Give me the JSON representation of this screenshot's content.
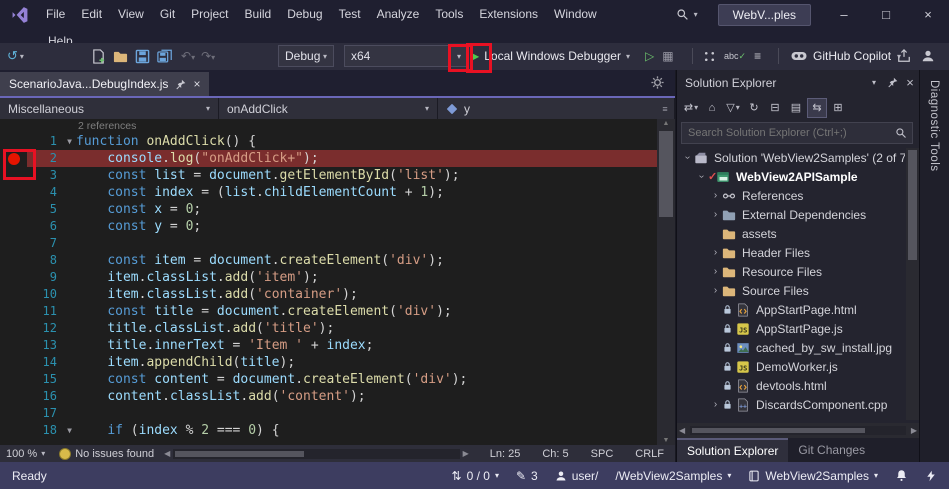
{
  "colors": {
    "titlebar_bg": "#1f1f30",
    "toolbar_bg": "#2d2d3d",
    "editor_bg": "#1e1e1e",
    "panel_bg": "#24242f",
    "statusbar_bg": "#3d3d60",
    "accent_line": "#6a67b8",
    "annotation_red": "#e81123",
    "breakpoint_red": "#e51400",
    "breakpoint_line_bg": "#7a2d2d",
    "start_green": "#4ec94e",
    "kw": "#569cd6",
    "ident": "#9cdcfe",
    "func": "#dcdcaa",
    "string": "#d69d85",
    "number": "#b5cea8",
    "punct": "#d4d4d4",
    "linenum": "#2b91af",
    "codelens": "#7f7f7f"
  },
  "titlebar": {
    "menus": [
      "File",
      "Edit",
      "View",
      "Git",
      "Project",
      "Build",
      "Debug",
      "Test",
      "Analyze",
      "Tools",
      "Extensions",
      "Window"
    ],
    "menus_wrapped": [
      "Help"
    ],
    "window_title": "WebV...ples"
  },
  "toolbar": {
    "debug_target": "Debug",
    "platform": "x64",
    "start_label": "Local Windows Debugger",
    "spell_label": "abc",
    "copilot_label": "GitHub Copilot"
  },
  "editor": {
    "tab_title": "ScenarioJava...DebugIndex.js",
    "nav": {
      "project": "Miscellaneous",
      "member": "onAddClick",
      "symbol": "y"
    },
    "codelens": "2 references",
    "status": {
      "zoom": "100 %",
      "issues": "No issues found",
      "ln": "Ln: 25",
      "ch": "Ch: 5",
      "enc": "SPC",
      "eol": "CRLF"
    },
    "lines": [
      {
        "n": 1,
        "fold": true,
        "t": [
          [
            "kw",
            "function"
          ],
          [
            "pl",
            " "
          ],
          [
            "fn",
            "onAddClick"
          ],
          [
            "pl",
            "() {"
          ]
        ]
      },
      {
        "n": 2,
        "bp": true,
        "hl": true,
        "t": [
          [
            "pl",
            "    "
          ],
          [
            "vr",
            "console"
          ],
          [
            "pl",
            "."
          ],
          [
            "fn",
            "log"
          ],
          [
            "pl",
            "("
          ],
          [
            "st",
            "\"onAddClick+\""
          ],
          [
            "pl",
            ");"
          ]
        ]
      },
      {
        "n": 3,
        "t": [
          [
            "pl",
            "    "
          ],
          [
            "kw",
            "const"
          ],
          [
            "pl",
            " "
          ],
          [
            "vr",
            "list"
          ],
          [
            "pl",
            " = "
          ],
          [
            "vr",
            "document"
          ],
          [
            "pl",
            "."
          ],
          [
            "fn",
            "getElementById"
          ],
          [
            "pl",
            "("
          ],
          [
            "st",
            "'list'"
          ],
          [
            "pl",
            ");"
          ]
        ]
      },
      {
        "n": 4,
        "t": [
          [
            "pl",
            "    "
          ],
          [
            "kw",
            "const"
          ],
          [
            "pl",
            " "
          ],
          [
            "vr",
            "index"
          ],
          [
            "pl",
            " = ("
          ],
          [
            "vr",
            "list"
          ],
          [
            "pl",
            "."
          ],
          [
            "vr",
            "childElementCount"
          ],
          [
            "pl",
            " + "
          ],
          [
            "nm",
            "1"
          ],
          [
            "pl",
            ");"
          ]
        ]
      },
      {
        "n": 5,
        "t": [
          [
            "pl",
            "    "
          ],
          [
            "kw",
            "const"
          ],
          [
            "pl",
            " "
          ],
          [
            "vr",
            "x"
          ],
          [
            "pl",
            " = "
          ],
          [
            "nm",
            "0"
          ],
          [
            "pl",
            ";"
          ]
        ]
      },
      {
        "n": 6,
        "t": [
          [
            "pl",
            "    "
          ],
          [
            "kw",
            "const"
          ],
          [
            "pl",
            " "
          ],
          [
            "vr",
            "y"
          ],
          [
            "pl",
            " = "
          ],
          [
            "nm",
            "0"
          ],
          [
            "pl",
            ";"
          ]
        ]
      },
      {
        "n": 7,
        "t": []
      },
      {
        "n": 8,
        "t": [
          [
            "pl",
            "    "
          ],
          [
            "kw",
            "const"
          ],
          [
            "pl",
            " "
          ],
          [
            "vr",
            "item"
          ],
          [
            "pl",
            " = "
          ],
          [
            "vr",
            "document"
          ],
          [
            "pl",
            "."
          ],
          [
            "fn",
            "createElement"
          ],
          [
            "pl",
            "("
          ],
          [
            "st",
            "'div'"
          ],
          [
            "pl",
            ");"
          ]
        ]
      },
      {
        "n": 9,
        "t": [
          [
            "pl",
            "    "
          ],
          [
            "vr",
            "item"
          ],
          [
            "pl",
            "."
          ],
          [
            "vr",
            "classList"
          ],
          [
            "pl",
            "."
          ],
          [
            "fn",
            "add"
          ],
          [
            "pl",
            "("
          ],
          [
            "st",
            "'item'"
          ],
          [
            "pl",
            ");"
          ]
        ]
      },
      {
        "n": 10,
        "t": [
          [
            "pl",
            "    "
          ],
          [
            "vr",
            "item"
          ],
          [
            "pl",
            "."
          ],
          [
            "vr",
            "classList"
          ],
          [
            "pl",
            "."
          ],
          [
            "fn",
            "add"
          ],
          [
            "pl",
            "("
          ],
          [
            "st",
            "'container'"
          ],
          [
            "pl",
            ");"
          ]
        ]
      },
      {
        "n": 11,
        "t": [
          [
            "pl",
            "    "
          ],
          [
            "kw",
            "const"
          ],
          [
            "pl",
            " "
          ],
          [
            "vr",
            "title"
          ],
          [
            "pl",
            " = "
          ],
          [
            "vr",
            "document"
          ],
          [
            "pl",
            "."
          ],
          [
            "fn",
            "createElement"
          ],
          [
            "pl",
            "("
          ],
          [
            "st",
            "'div'"
          ],
          [
            "pl",
            ");"
          ]
        ]
      },
      {
        "n": 12,
        "t": [
          [
            "pl",
            "    "
          ],
          [
            "vr",
            "title"
          ],
          [
            "pl",
            "."
          ],
          [
            "vr",
            "classList"
          ],
          [
            "pl",
            "."
          ],
          [
            "fn",
            "add"
          ],
          [
            "pl",
            "("
          ],
          [
            "st",
            "'title'"
          ],
          [
            "pl",
            ");"
          ]
        ]
      },
      {
        "n": 13,
        "t": [
          [
            "pl",
            "    "
          ],
          [
            "vr",
            "title"
          ],
          [
            "pl",
            "."
          ],
          [
            "vr",
            "innerText"
          ],
          [
            "pl",
            " = "
          ],
          [
            "st",
            "'Item '"
          ],
          [
            "pl",
            " + "
          ],
          [
            "vr",
            "index"
          ],
          [
            "pl",
            ";"
          ]
        ]
      },
      {
        "n": 14,
        "t": [
          [
            "pl",
            "    "
          ],
          [
            "vr",
            "item"
          ],
          [
            "pl",
            "."
          ],
          [
            "fn",
            "appendChild"
          ],
          [
            "pl",
            "("
          ],
          [
            "vr",
            "title"
          ],
          [
            "pl",
            ");"
          ]
        ]
      },
      {
        "n": 15,
        "t": [
          [
            "pl",
            "    "
          ],
          [
            "kw",
            "const"
          ],
          [
            "pl",
            " "
          ],
          [
            "vr",
            "content"
          ],
          [
            "pl",
            " = "
          ],
          [
            "vr",
            "document"
          ],
          [
            "pl",
            "."
          ],
          [
            "fn",
            "createElement"
          ],
          [
            "pl",
            "("
          ],
          [
            "st",
            "'div'"
          ],
          [
            "pl",
            ");"
          ]
        ]
      },
      {
        "n": 16,
        "t": [
          [
            "pl",
            "    "
          ],
          [
            "vr",
            "content"
          ],
          [
            "pl",
            "."
          ],
          [
            "vr",
            "classList"
          ],
          [
            "pl",
            "."
          ],
          [
            "fn",
            "add"
          ],
          [
            "pl",
            "("
          ],
          [
            "st",
            "'content'"
          ],
          [
            "pl",
            ");"
          ]
        ]
      },
      {
        "n": 17,
        "t": []
      },
      {
        "n": 18,
        "fold": true,
        "t": [
          [
            "pl",
            "    "
          ],
          [
            "kw",
            "if"
          ],
          [
            "pl",
            " ("
          ],
          [
            "vr",
            "index"
          ],
          [
            "pl",
            " % "
          ],
          [
            "nm",
            "2"
          ],
          [
            "pl",
            " === "
          ],
          [
            "nm",
            "0"
          ],
          [
            "pl",
            ") {"
          ]
        ]
      }
    ]
  },
  "solution_explorer": {
    "title": "Solution Explorer",
    "search_placeholder": "Search Solution Explorer (Ctrl+;)",
    "tree": [
      {
        "label": "Solution 'WebView2Samples' (2 of 7 ...",
        "level": 0,
        "chevron": "expanded",
        "icon": "solution-icon"
      },
      {
        "label": "WebView2APISample",
        "level": 1,
        "chevron": "expanded",
        "icon": "project-icon",
        "bold": true,
        "badge": "check"
      },
      {
        "label": "References",
        "level": 2,
        "chevron": "collapsed",
        "icon": "references-icon"
      },
      {
        "label": "External Dependencies",
        "level": 2,
        "chevron": "collapsed",
        "icon": "dependencies-icon"
      },
      {
        "label": "assets",
        "level": 2,
        "chevron": "none",
        "icon": "folder-icon"
      },
      {
        "label": "Header Files",
        "level": 2,
        "chevron": "collapsed",
        "icon": "folder-icon"
      },
      {
        "label": "Resource Files",
        "level": 2,
        "chevron": "collapsed",
        "icon": "folder-icon"
      },
      {
        "label": "Source Files",
        "level": 2,
        "chevron": "collapsed",
        "icon": "folder-icon"
      },
      {
        "label": "AppStartPage.html",
        "level": 2,
        "chevron": "none",
        "icon": "html-file-icon",
        "lock": true
      },
      {
        "label": "AppStartPage.js",
        "level": 2,
        "chevron": "none",
        "icon": "js-file-icon",
        "lock": true
      },
      {
        "label": "cached_by_sw_install.jpg",
        "level": 2,
        "chevron": "none",
        "icon": "image-file-icon",
        "lock": true
      },
      {
        "label": "DemoWorker.js",
        "level": 2,
        "chevron": "none",
        "icon": "js-file-icon",
        "lock": true
      },
      {
        "label": "devtools.html",
        "level": 2,
        "chevron": "none",
        "icon": "html-file-icon",
        "lock": true
      },
      {
        "label": "DiscardsComponent.cpp",
        "level": 2,
        "chevron": "collapsed",
        "icon": "cpp-file-icon",
        "lock": true
      }
    ],
    "tabs": [
      {
        "label": "Solution Explorer"
      },
      {
        "label": "Git Changes"
      }
    ]
  },
  "right_strip": {
    "label": "Diagnostic Tools"
  },
  "statusbar": {
    "ready": "Ready",
    "sync_count": "0 / 0",
    "edits_count": "3",
    "branch_prefix": "user/",
    "branch_suffix": "/WebView2Samples",
    "repo_name": "WebView2Samples"
  }
}
